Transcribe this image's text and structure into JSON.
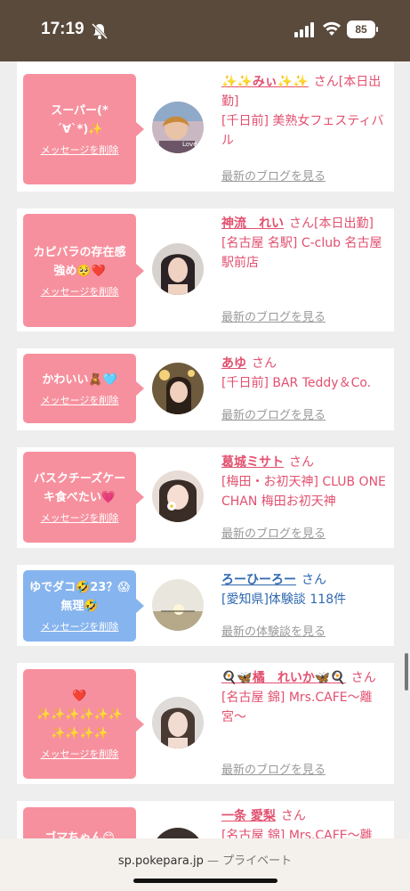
{
  "status_bar": {
    "time": "17:19",
    "battery": "85"
  },
  "cards": [
    {
      "message": "スーパー(*´∀`*)✨",
      "delete_label": "メッセージを削除",
      "name": "✨✨みぃ✨✨",
      "honorific": "さん",
      "status": "[本日出勤]",
      "shop": "[千日前] 美熟女フェスティバル",
      "link": "最新のブログを見る"
    },
    {
      "message": "カピバラの存在感強め🥺❤️",
      "delete_label": "メッセージを削除",
      "name": "神流　れい",
      "honorific": "さん",
      "status": "[本日出勤]",
      "shop": "[名古屋 名駅] C-club 名古屋駅前店",
      "link": "最新のブログを見る"
    },
    {
      "message": "かわいい🧸🩵",
      "delete_label": "メッセージを削除",
      "name": "あゆ",
      "honorific": "さん",
      "shop": "[千日前] BAR Teddy＆Co.",
      "link": "最新のブログを見る"
    },
    {
      "message": "バスクチーズケーキ食べたい💗",
      "delete_label": "メッセージを削除",
      "name": "葛城ミサト",
      "honorific": "さん",
      "shop": "[梅田・お初天神] CLUB ONE CHAN 梅田お初天神",
      "link": "最新のブログを見る"
    },
    {
      "message": "ゆでダコ🤣23？😱無理🤣",
      "delete_label": "メッセージを削除",
      "name": "ろーひーろー",
      "honorific": "さん",
      "shop": "[愛知県]体験談 118件",
      "link": "最新の体験談を見る"
    },
    {
      "message": "❤️ ✨✨✨✨✨✨ ✨✨✨✨",
      "delete_label": "メッセージを削除",
      "name": "🍳🦋橘　れいか🦋🍳",
      "honorific": "さん",
      "shop": "[名古屋 錦] Mrs.CAFE〜離宮〜",
      "link": "最新のブログを見る"
    },
    {
      "message": "ゴマちゃん😊",
      "name": "一条 愛梨",
      "honorific": "さん",
      "shop": "[名古屋 錦] Mrs.CAFE〜離"
    }
  ],
  "browser": {
    "url": "sp.pokepara.jp",
    "privacy": "— プライベート"
  },
  "colors": {
    "accent_pink": "#f7909e",
    "accent_blue": "#86b4ee",
    "name_pink": "#e2506f",
    "name_blue": "#2f69b0",
    "header_brown": "#5a4a3c"
  }
}
